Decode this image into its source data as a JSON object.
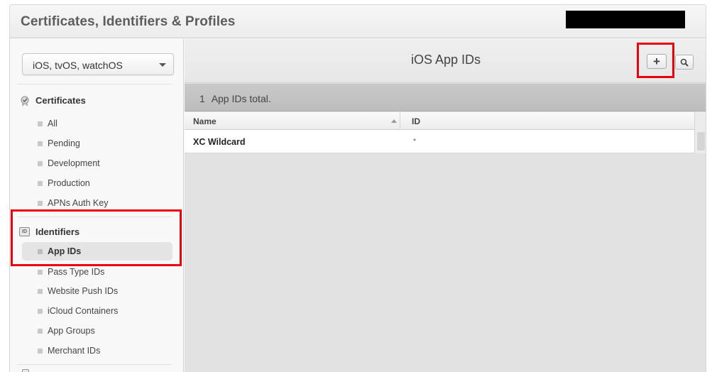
{
  "app": {
    "title": "Certificates, Identifiers & Profiles"
  },
  "sidebar": {
    "platform": "iOS, tvOS, watchOS",
    "certificates": {
      "heading": "Certificates",
      "items": [
        "All",
        "Pending",
        "Development",
        "Production",
        "APNs Auth Key"
      ]
    },
    "identifiers": {
      "heading": "Identifiers",
      "icon_label": "ID",
      "items": [
        "App IDs",
        "Pass Type IDs",
        "Website Push IDs",
        "iCloud Containers",
        "App Groups",
        "Merchant IDs"
      ],
      "active": "App IDs"
    }
  },
  "main": {
    "title": "iOS App IDs",
    "add_label": "+",
    "count_number": "1",
    "count_text": "App IDs total.",
    "table": {
      "columns": [
        "Name",
        "ID"
      ],
      "rows": [
        {
          "name": "XC Wildcard",
          "id": "*"
        }
      ]
    }
  },
  "colors": {
    "highlight": "#e8000b",
    "count_bar": "#c4c4c4",
    "background": "#e2e2e2"
  }
}
